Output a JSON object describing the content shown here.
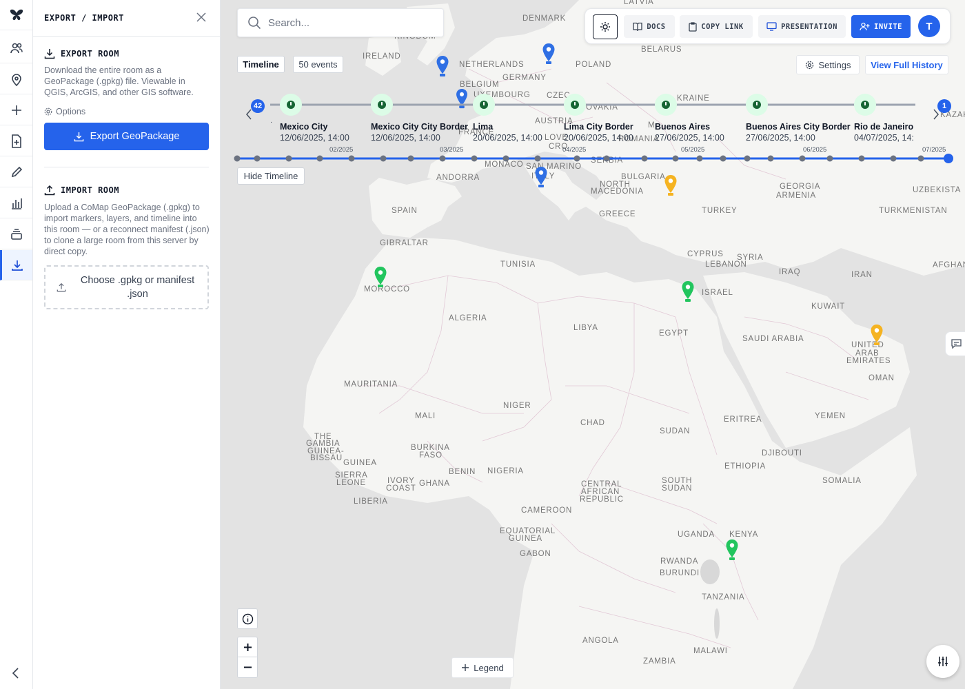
{
  "rail": {
    "items": [
      {
        "icon": "butterfly-logo-icon",
        "active": false
      },
      {
        "icon": "users-icon",
        "active": false
      },
      {
        "icon": "map-pin-icon",
        "active": false
      },
      {
        "icon": "plus-icon",
        "active": false
      },
      {
        "icon": "file-plus-icon",
        "active": false
      },
      {
        "icon": "pencil-icon",
        "active": false
      },
      {
        "icon": "bar-chart-icon",
        "active": false
      },
      {
        "icon": "layers-icon",
        "active": false
      },
      {
        "icon": "download-icon",
        "active": true
      }
    ],
    "collapse_icon": "chevron-left-icon"
  },
  "panel": {
    "title": "EXPORT / IMPORT",
    "export": {
      "heading": "EXPORT ROOM",
      "description": "Download the entire room as a GeoPackage (.gpkg) file. Viewable in QGIS, ArcGIS, and other GIS software.",
      "options_label": "Options",
      "button_label": "Export GeoPackage"
    },
    "import": {
      "heading": "IMPORT ROOM",
      "description": "Upload a CoMap GeoPackage (.gpkg) to import markers, layers, and timeline into this room — or a reconnect manifest (.json) to clone a large room from this server by direct copy.",
      "dropzone_label": "Choose .gpkg or manifest .json"
    }
  },
  "search": {
    "placeholder": "Search..."
  },
  "toolbar": {
    "docs": "DOCS",
    "copy_link": "COPY LINK",
    "presentation": "PRESENTATION",
    "invite": "INVITE",
    "avatar_initial": "T"
  },
  "timeline": {
    "tab_label": "Timeline",
    "events_count": "50 events",
    "settings_label": "Settings",
    "view_history_label": "View Full History",
    "hide_label": "Hide Timeline",
    "left_badge": "42",
    "right_badge": "1",
    "dot_glyph": "·",
    "events": [
      {
        "title": "Mexico City",
        "date": "12/06/2025, 14:00"
      },
      {
        "title": "Mexico City City Border",
        "date": "12/06/2025, 14:00"
      },
      {
        "title": "Lima",
        "date": "20/06/2025, 14:00"
      },
      {
        "title": "Lima City Border",
        "date": "20/06/2025, 14:00"
      },
      {
        "title": "Buenos Aires",
        "date": "27/06/2025, 14:00"
      },
      {
        "title": "Buenos Aires City Border",
        "date": "27/06/2025, 14:00"
      },
      {
        "title": "Rio de Janeiro",
        "date": "04/07/2025, 14:"
      }
    ],
    "months": [
      "02/2025",
      "03/2025",
      "04/2025",
      "05/2025",
      "06/2025",
      "07/2025"
    ]
  },
  "map": {
    "labels": {
      "latvia": "LATVIA",
      "denmark": "DENMARK",
      "kingdom": "KINGDOM",
      "ireland": "IRELAND",
      "netherlands": "NETHERLANDS",
      "belarus": "BELARUS",
      "poland": "POLAND",
      "germany": "GERMANY",
      "belgium": "BELGIUM",
      "luxembourg": "UXEMBOURG",
      "czech": "CZEC",
      "ukraine": "KRAINE",
      "slovakia": "OVAKIA",
      "austria": "AUSTRIA",
      "france": "FRANCE",
      "moldova": "M",
      "slovenia": "LOVE",
      "croatia": "CRO",
      "romania": "ROMANIA",
      "monaco": "MONACO",
      "san_marino": "SAN MARINO",
      "serbia": "SERBIA",
      "kazakhstan": "KAZAK",
      "andorra": "ANDORRA",
      "italy": "ITALY",
      "bulgaria": "BULGARIA",
      "georgia": "GEORGIA",
      "armenia": "ARMENIA",
      "uzbekistan": "UZBEKISTA",
      "north_macedonia_1": "NORTH",
      "north_macedonia_2": "MACEDONIA",
      "spain": "SPAIN",
      "turkey": "TURKEY",
      "turkmenistan": "TURKMENISTAN",
      "greece": "GREECE",
      "gibraltar": "GIBRALTAR",
      "tunisia": "TUNISIA",
      "cyprus": "CYPRUS",
      "syria": "SYRIA",
      "lebanon": "LEBANON",
      "afghanistan": "AFGHAN",
      "iraq": "IRAQ",
      "iran": "IRAN",
      "morocco": "MOROCCO",
      "israel": "ISRAEL",
      "kuwait": "KUWAIT",
      "algeria": "ALGERIA",
      "libya": "LIBYA",
      "egypt": "EGYPT",
      "saudi_arabia": "SAUDI ARABIA",
      "uae_1": "UNITED",
      "uae_2": "ARAB",
      "uae_3": "EMIRATES",
      "oman": "OMAN",
      "mauritania": "MAURITANIA",
      "niger": "NIGER",
      "mali": "MALI",
      "chad": "CHAD",
      "sudan": "SUDAN",
      "eritrea": "ERITREA",
      "yemen": "YEMEN",
      "gambia_1": "THE",
      "gambia_2": "GAMBIA",
      "guinea_bissau_1": "GUINEA-",
      "guinea_bissau_2": "BISSAU",
      "burkina_1": "BURKINA",
      "burkina_2": "FASO",
      "guinea": "GUINEA",
      "djibouti": "DJIBOUTI",
      "ethiopia": "ETHIOPIA",
      "benin": "BENIN",
      "nigeria": "NIGERIA",
      "sierra_1": "SIERRA",
      "sierra_2": "LEONE",
      "ivory_1": "IVORY",
      "ivory_2": "COAST",
      "ghana": "GHANA",
      "south_sudan_1": "SOUTH",
      "south_sudan_2": "SUDAN",
      "somalia": "SOMALIA",
      "car_1": "CENTRAL",
      "car_2": "AFRICAN",
      "car_3": "REPUBLIC",
      "liberia": "LIBERIA",
      "cameroon": "CAMEROON",
      "eq_guinea_1": "EQUATORIAL",
      "eq_guinea_2": "GUINEA",
      "uganda": "UGANDA",
      "kenya": "KENYA",
      "gabon": "GABON",
      "rwanda": "RWANDA",
      "burundi": "BURUNDI",
      "tanzania": "TANZANIA",
      "angola": "ANGOLA",
      "malawi": "MALAWI",
      "zambia": "ZAMBIA"
    },
    "legend_label": "Legend",
    "colors": {
      "blue_pin": "#2f6fe4",
      "green_pin": "#22c55e",
      "yellow_pin": "#f5b321",
      "accent": "#2563eb"
    }
  }
}
